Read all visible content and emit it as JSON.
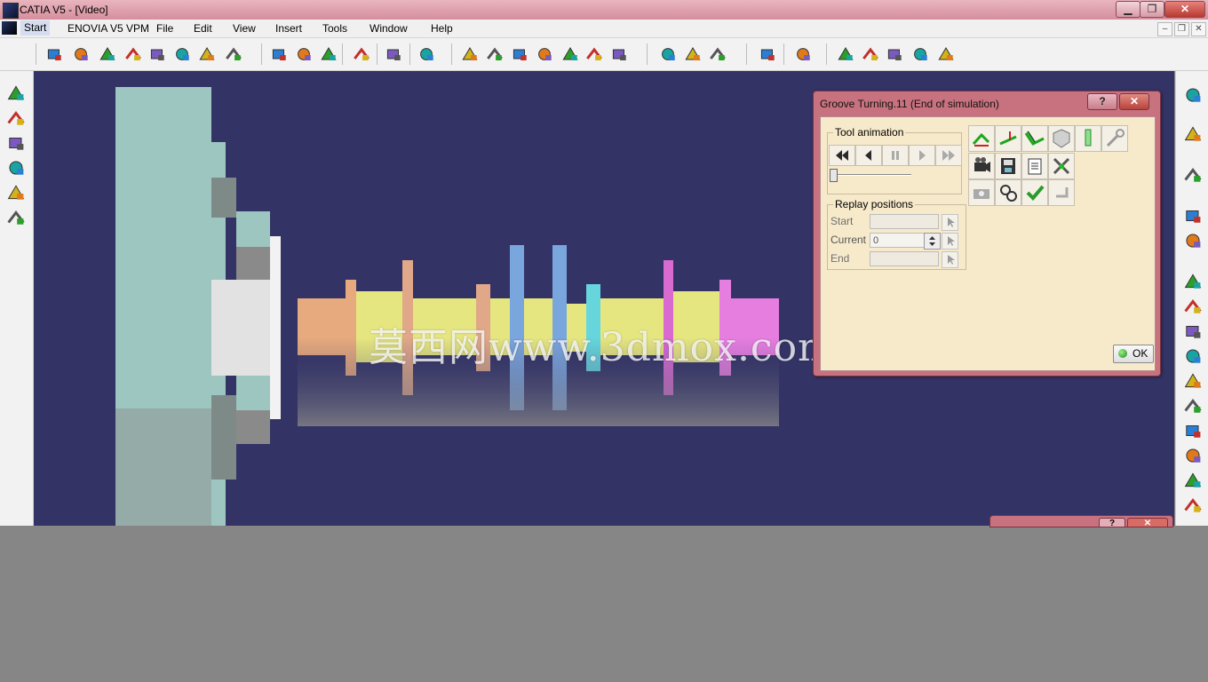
{
  "window": {
    "title": "CATIA V5 - [Video]",
    "controls": {
      "minimize": "▁",
      "restore": "❐",
      "close": "✕"
    }
  },
  "menu": {
    "items": [
      "Start",
      "ENOVIA V5 VPM",
      "File",
      "Edit",
      "View",
      "Insert",
      "Tools",
      "Window",
      "Help"
    ],
    "mdi": {
      "minimize": "–",
      "restore": "❐",
      "close": "✕"
    }
  },
  "dialog": {
    "title": "Groove Turning.11 (End of simulation)",
    "help": "?",
    "close": "✕",
    "tool_animation": {
      "label": "Tool animation",
      "buttons": [
        "rewind",
        "step-back",
        "pause",
        "play",
        "fast-forward"
      ],
      "progress": 0.0
    },
    "replay_positions": {
      "label": "Replay positions",
      "start_label": "Start",
      "start_value": "",
      "current_label": "Current",
      "current_value": "0",
      "end_label": "End",
      "end_value": ""
    },
    "ok_label": "OK"
  },
  "dialog2": {
    "help": "?",
    "close": "✕"
  },
  "watermark": "莫西网www.3dmox.com",
  "colors": {
    "viewport": "#333366",
    "titlebar": "#d58e9c",
    "dialog_frame": "#c8727f",
    "dialog_body": "#f7eacb"
  },
  "icons": {
    "toolbar": [
      "sketcher-icon",
      "snap-icon",
      "move-icon",
      "rotate-icon",
      "constraint-icon",
      "measure-icon",
      "tree-icon",
      "compass-icon",
      "part-icon",
      "stock-icon",
      "material-icon",
      "link-icon",
      "filter-icon",
      "turning-icon",
      "machine-icon",
      "program-icon",
      "operation-icon",
      "tool-path-icon",
      "document-icon",
      "cut-icon",
      "video-icon",
      "simulate-icon",
      "flag-icon",
      "play-path-icon",
      "replay-icon",
      "parameter-icon",
      "axis-icon",
      "tool-change-icon",
      "transform-icon",
      "rotate-machine-icon",
      "export-icon"
    ],
    "left": [
      "turning-op-icon",
      "facing-icon",
      "groove-icon",
      "profile-icon",
      "thread-icon",
      "roughing-icon"
    ],
    "right": [
      "render-icon",
      "fly-icon",
      "select-icon",
      "analysis-icon",
      "sheet-icon",
      "macro1-icon",
      "macro2-icon",
      "macro3-icon",
      "macro4-icon",
      "macro5-icon",
      "macro6-icon",
      "macro7-icon",
      "macro8-icon",
      "macro9-icon",
      "macro10-icon"
    ]
  }
}
